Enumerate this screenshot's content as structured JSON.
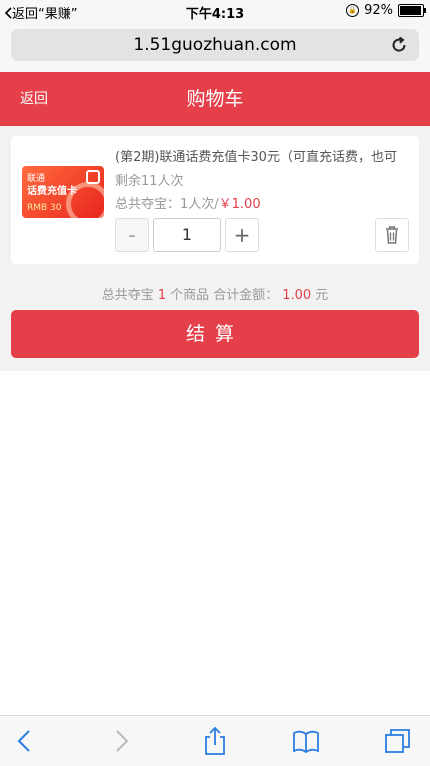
{
  "status_bar": {
    "back_app": "返回“果赚”",
    "time": "下午4:13",
    "battery_percent": "92%",
    "battery_level": 0.92
  },
  "browser": {
    "url": "1.51guozhuan.com"
  },
  "header": {
    "back_label": "返回",
    "title": "购物车"
  },
  "cart_item": {
    "name": "(第2期)联通话费充值卡30元（可直充话费，也可",
    "remaining": "剩余11人次",
    "total_label": "总共夺宝：1人次/",
    "price": "￥1.00",
    "quantity": "1",
    "minus_label": "-",
    "plus_label": "+",
    "thumb": {
      "line1": "联通",
      "line2": "话费充值卡",
      "line3": "RMB 30"
    }
  },
  "summary": {
    "prefix": "总共夺宝",
    "count": "1",
    "middle": "个商品 合计金额：",
    "amount": "1.00",
    "suffix": "元"
  },
  "checkout_label": "结算",
  "colors": {
    "accent": "#e53f4a",
    "ios_blue": "#2a7de1"
  }
}
